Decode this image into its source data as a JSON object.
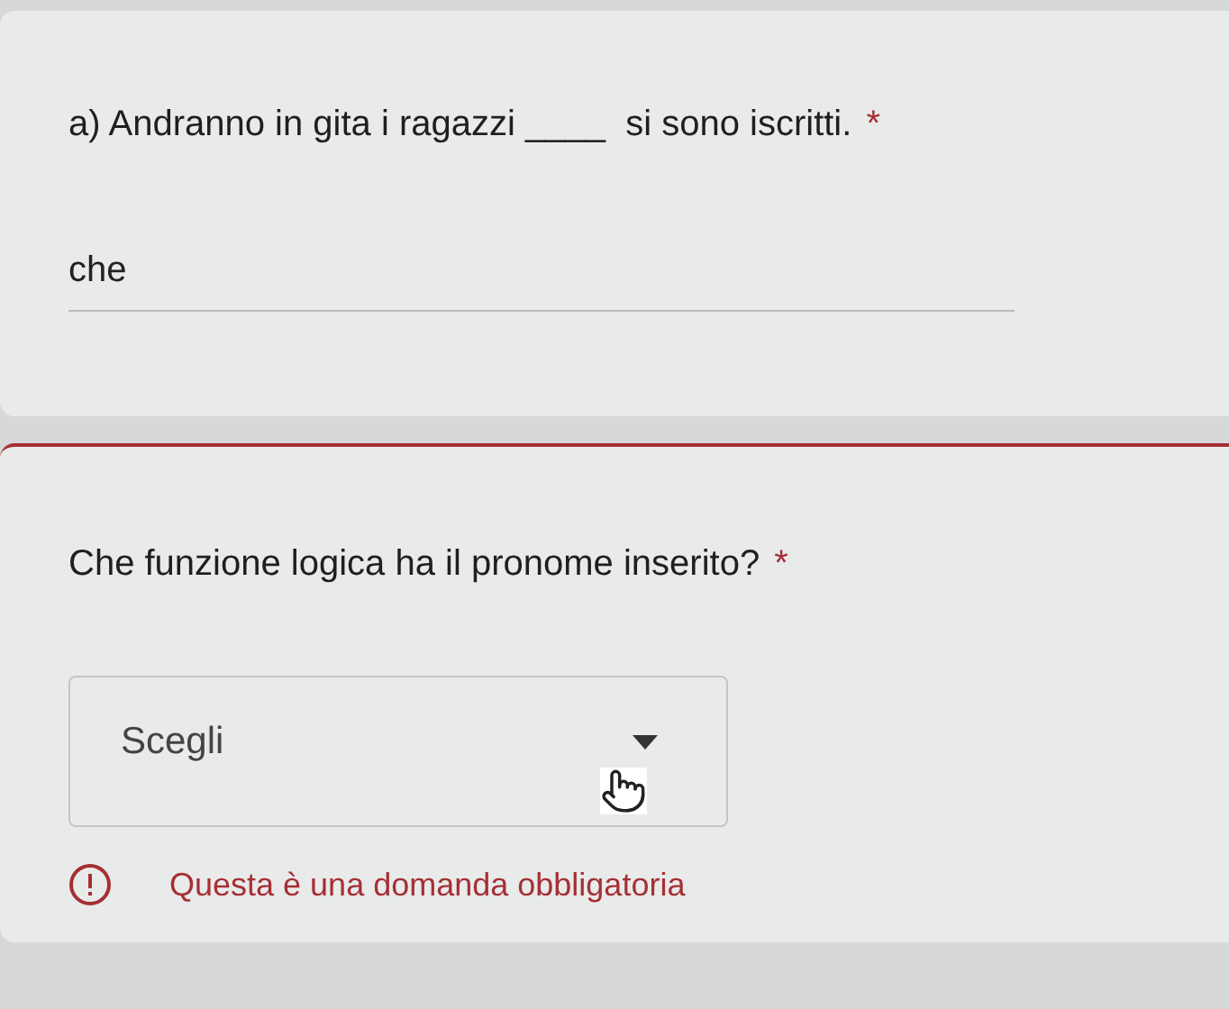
{
  "questions": [
    {
      "kind": "text",
      "title": "a) Andranno in gita i ragazzi ____  si sono iscritti.",
      "required_mark": "*",
      "value": "che"
    },
    {
      "kind": "dropdown",
      "title": "Che funzione logica ha il pronome inserito?",
      "required_mark": "*",
      "placeholder": "Scegli",
      "error": "Questa è una domanda obbligatoria"
    }
  ]
}
